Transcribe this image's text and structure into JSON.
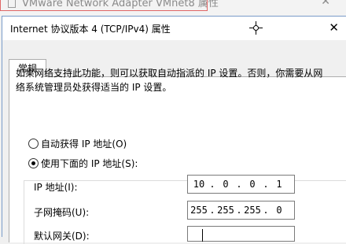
{
  "background_window": {
    "title": "VMware Network Adapter VMnet8 属性",
    "close_glyph": "✕"
  },
  "dialog": {
    "title": "Internet 协议版本 4 (TCP/IPv4) 属性",
    "close_glyph": "✕",
    "tabs": [
      {
        "label": "常规"
      }
    ],
    "description": "如果网络支持此功能，则可以获取自动指派的 IP 设置。否则，你需要从网络系统管理员处获得适当的 IP 设置。",
    "radio_auto": {
      "label": "自动获得 IP 地址(O)",
      "selected": false
    },
    "radio_manual": {
      "label": "使用下面的 IP 地址(S):",
      "selected": true
    },
    "fields": {
      "ip": {
        "label": "IP 地址(I):",
        "octets": [
          "10",
          "0",
          "0",
          "1"
        ]
      },
      "mask": {
        "label": "子网掩码(U):",
        "octets": [
          "255",
          "255",
          "255",
          "0"
        ]
      },
      "gateway": {
        "label": "默认网关(D):",
        "octets": [
          "",
          "",
          "",
          ""
        ]
      }
    },
    "separator": "."
  },
  "colors": {
    "accent_border": "#7a9cc9",
    "highlight_red": "#e06666"
  }
}
